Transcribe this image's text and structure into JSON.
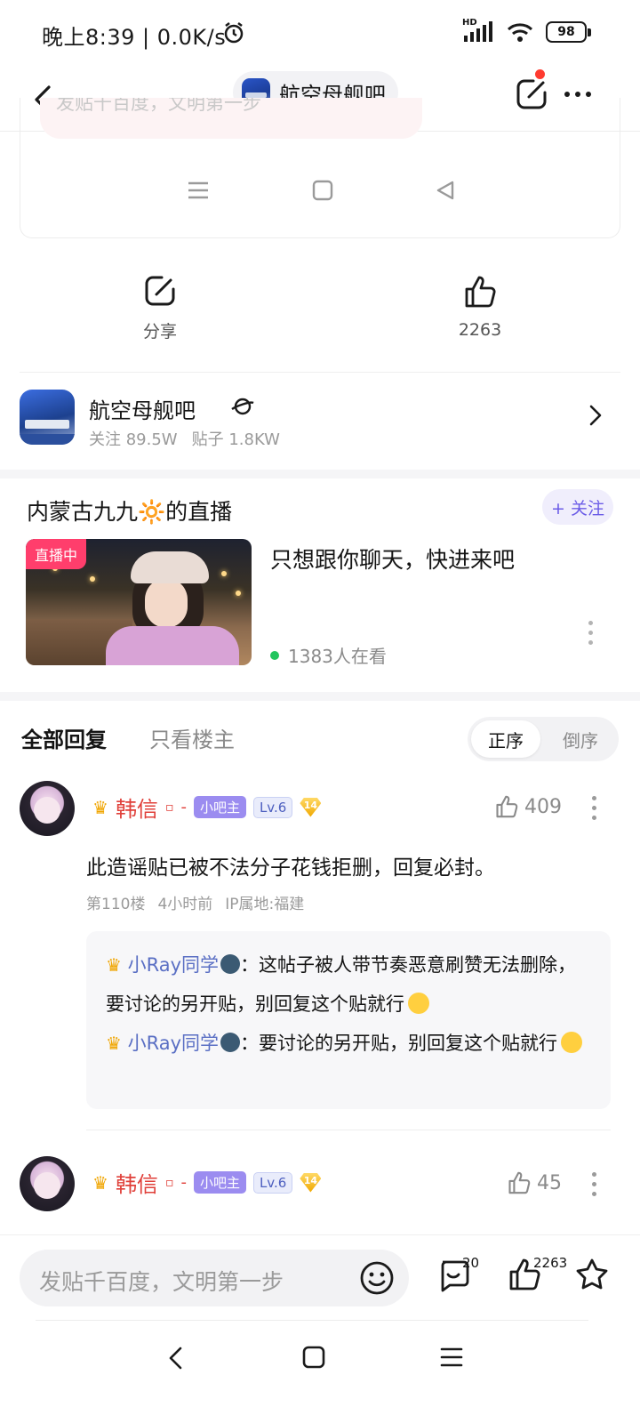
{
  "status_bar": {
    "time_speed": "晚上8:39 | 0.0K/s",
    "network": "HD",
    "battery": "98"
  },
  "header": {
    "forum_name": "航空母舰吧"
  },
  "embed": {
    "ghost_placeholder": "发贴千百度，文明第一步"
  },
  "actions": {
    "share_label": "分享",
    "like_count": "2263"
  },
  "forum": {
    "name": "航空母舰吧",
    "followers": "关注 89.5W",
    "posts": "贴子 1.8KW"
  },
  "live": {
    "title": "内蒙古九九🔆的直播",
    "follow_label": "+ 关注",
    "badge": "直播中",
    "description": "只想跟你聊天，快进来吧",
    "viewers": "1383人在看"
  },
  "reply_tabs": {
    "all": "全部回复",
    "op_only": "只看楼主",
    "asc": "正序",
    "desc": "倒序"
  },
  "replies": [
    {
      "username": "韩信",
      "role": "小吧主",
      "level": "Lv.6",
      "badge_num": "14",
      "likes": "409",
      "text": "此造谣贴已被不法分子花钱拒删，回复必封。",
      "floor": "第110楼",
      "time": "4小时前",
      "ip": "IP属地:福建",
      "sub_replies": [
        {
          "user": "小Ray同学",
          "text": "：这帖子被人带节奏恶意刷赞无法删除，要讨论的另开贴，别回复这个贴就行"
        },
        {
          "user": "小Ray同学",
          "text": "：要讨论的另开贴，别回复这个贴就行"
        }
      ]
    },
    {
      "username": "韩信",
      "role": "小吧主",
      "level": "Lv.6",
      "badge_num": "14",
      "likes": "45"
    }
  ],
  "compose": {
    "placeholder": "发贴千百度，文明第一步",
    "comment_count": "20",
    "like_count": "2263"
  },
  "colors": {
    "accent_purple": "#6b5ce7",
    "username_red": "#e0403a",
    "live_pink": "#ff3e6c",
    "online_green": "#22c55e"
  }
}
